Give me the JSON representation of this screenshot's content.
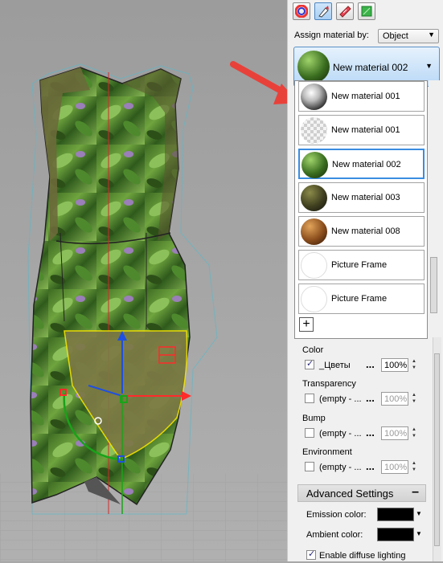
{
  "toolbar": {
    "buttons": [
      {
        "icon": "color-wheel-icon"
      },
      {
        "icon": "material-brush-icon"
      },
      {
        "icon": "fabric-texture-icon"
      },
      {
        "icon": "uv-map-icon"
      }
    ]
  },
  "assign": {
    "label": "Assign material by:",
    "value": "Object"
  },
  "current_material": {
    "label": "New material 002"
  },
  "material_list": [
    {
      "label": "New material 001",
      "thumb": "chrome"
    },
    {
      "label": "New material 001",
      "thumb": "transparent"
    },
    {
      "label": "New material 002",
      "thumb": "green-leaf",
      "selected": true
    },
    {
      "label": "New material 003",
      "thumb": "dark-olive"
    },
    {
      "label": "New material 008",
      "thumb": "wood"
    },
    {
      "label": "Picture Frame",
      "thumb": "white"
    },
    {
      "label": "Picture Frame",
      "thumb": "white"
    }
  ],
  "add_button": "+",
  "channels": {
    "color": {
      "title": "Color",
      "map": "_Цветы",
      "amount": "100%",
      "checked": true
    },
    "transparency": {
      "title": "Transparency",
      "map": "(empty - ...",
      "amount": "100%",
      "checked": false
    },
    "bump": {
      "title": "Bump",
      "map": "(empty - ...",
      "amount": "100%",
      "checked": false
    },
    "environment": {
      "title": "Environment",
      "map": "(empty - ...",
      "amount": "100%",
      "checked": false
    },
    "dots": "..."
  },
  "advanced": {
    "title": "Advanced Settings",
    "collapse": "–",
    "emission_label": "Emission color:",
    "emission_color": "#000000",
    "ambient_label": "Ambient color:",
    "ambient_color": "#000000",
    "diffuse_label": "Enable diffuse lighting",
    "diffuse_checked": true
  },
  "colors": {
    "arrow": "#e8413a",
    "accent": "#3a8de0",
    "gizmo_x": "#ff2a2a",
    "gizmo_y": "#1aa21a",
    "gizmo_z": "#1f4fe0",
    "selection": "#ffe600"
  }
}
